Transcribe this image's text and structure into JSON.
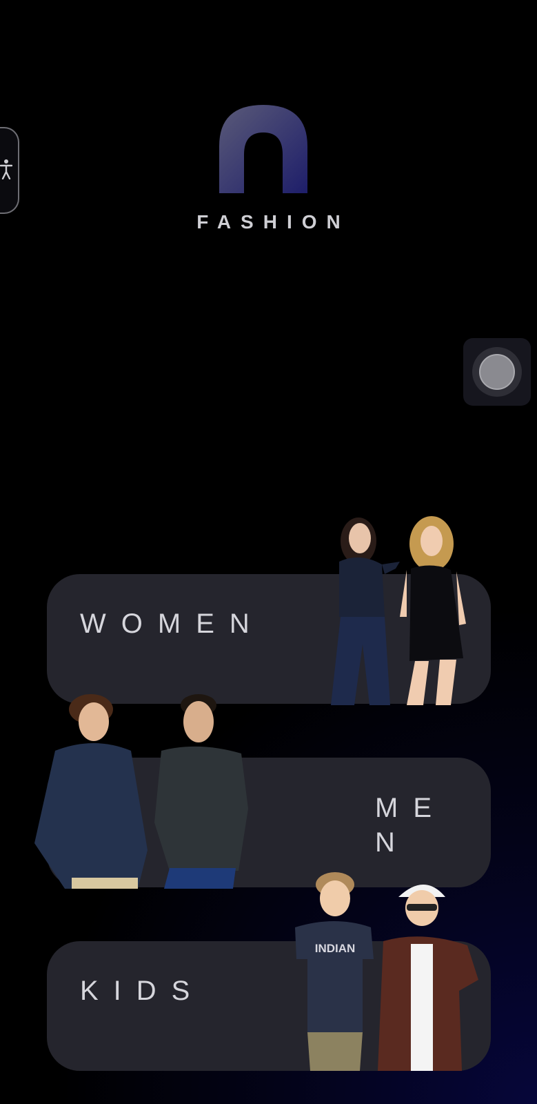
{
  "app": {
    "brand": "FASHION"
  },
  "icons": {
    "accessibility": "accessibility-person-icon",
    "logo": "fashion-logo-icon",
    "floating": "assistive-touch-icon"
  },
  "categories": [
    {
      "id": "women",
      "label": "WOMEN"
    },
    {
      "id": "men",
      "label": "MEN"
    },
    {
      "id": "kids",
      "label": "KIDS"
    }
  ],
  "kids_tshirt_text": "INDIAN",
  "colors": {
    "card": "#25252d",
    "label": "#d6d6dc",
    "accent": "#3a3a8a"
  }
}
